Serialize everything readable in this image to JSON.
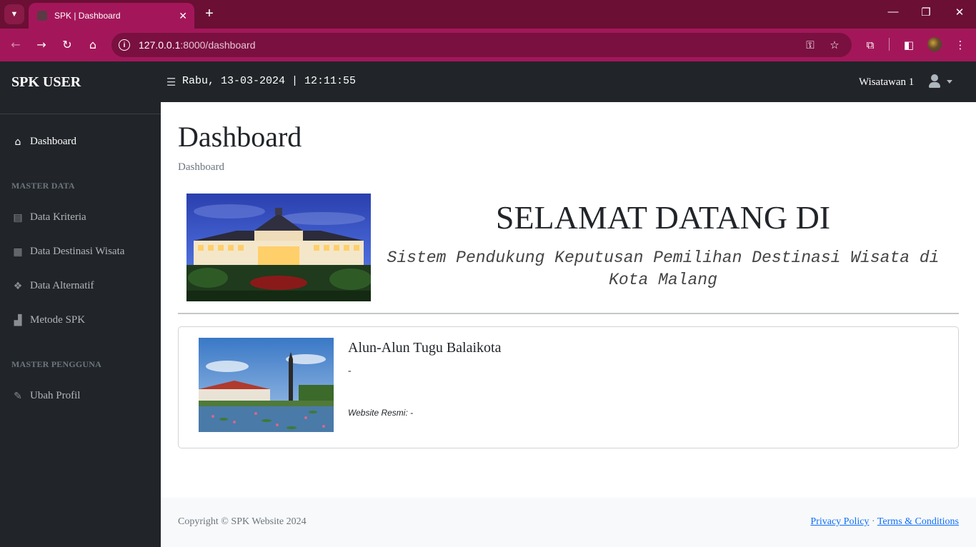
{
  "browser": {
    "tab_title": "SPK | Dashboard",
    "url_host": "127.0.0.1",
    "url_path": ":8000/dashboard"
  },
  "navbar": {
    "brand": "SPK USER",
    "datetime": "Rabu, 13-03-2024 | 12:11:55",
    "user_name": "Wisatawan 1"
  },
  "sidebar": {
    "dashboard": "Dashboard",
    "heading_master_data": "MASTER DATA",
    "items_master_data": [
      {
        "label": "Data Kriteria",
        "icon": "table-icon"
      },
      {
        "label": "Data Destinasi Wisata",
        "icon": "map-icon"
      },
      {
        "label": "Data Alternatif",
        "icon": "cubes-icon"
      },
      {
        "label": "Metode SPK",
        "icon": "sitemap-icon"
      }
    ],
    "heading_master_pengguna": "MASTER PENGGUNA",
    "ubah_profil": "Ubah Profil"
  },
  "main": {
    "title": "Dashboard",
    "breadcrumb": "Dashboard",
    "hero_title": "SELAMAT DATANG DI",
    "hero_subtitle": "Sistem Pendukung Keputusan Pemilihan Destinasi Wisata di Kota Malang",
    "destination": {
      "name": "Alun-Alun Tugu Balaikota",
      "description": "-",
      "website": "Website Resmi: -"
    }
  },
  "footer": {
    "copyright": "Copyright © SPK Website 2024",
    "privacy": "Privacy Policy",
    "separator": "·",
    "terms": "Terms & Conditions"
  }
}
